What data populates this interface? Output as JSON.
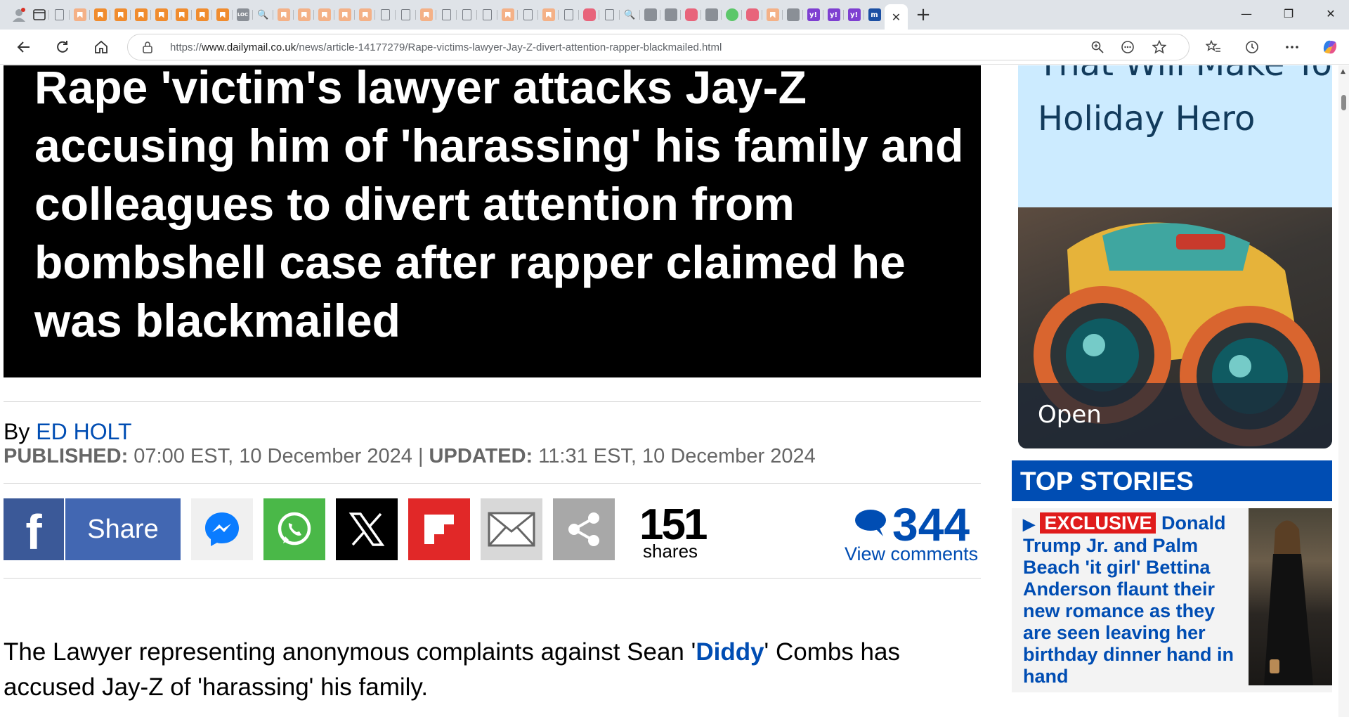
{
  "browser": {
    "url_prefix": "https://",
    "url_domain": "www.dailymail.co.uk",
    "url_path": "/news/article-14177279/Rape-victims-lawyer-Jay-Z-divert-attention-rapper-blackmailed.html",
    "tab_close_glyph": "✕",
    "new_tab_glyph": "+",
    "minimize_glyph": "—",
    "restore_glyph": "❐",
    "close_glyph": "✕",
    "tab_glyphs": {
      "bookmark_tab": "",
      "loc_tab": "LOC",
      "search_tab": "🔍",
      "yahoo_tab": "y!",
      "mail_tab": "m"
    }
  },
  "article": {
    "headline": "Rape 'victim's lawyer attacks Jay-Z accusing him of 'harassing' his family and colleagues to divert attention from bombshell case after rapper claimed he was blackmailed",
    "byline_prefix": "By ",
    "author": "ED HOLT",
    "published_label": "PUBLISHED:",
    "published_value": " 07:00 EST, 10 December 2024 ",
    "separator": "|",
    "updated_label": " UPDATED:",
    "updated_value": " 11:31 EST, 10 December 2024",
    "share_label": "Share",
    "shares_count": "151",
    "shares_label": "shares",
    "comments_count": "344",
    "view_comments": "View comments",
    "body_part1": " The Lawyer representing anonymous complaints against Sean '",
    "body_link": "Diddy",
    "body_part2": "' Combs has accused Jay-Z of 'harassing' his family."
  },
  "ad": {
    "top_line": "That Will Make You",
    "headline": "Holiday Hero",
    "open_label": "Open"
  },
  "sidebar": {
    "section_title": "TOP STORIES",
    "story_badge": "EXCLUSIVE",
    "story_text": " Donald Trump Jr. and Palm Beach 'it girl' Bettina Anderson flaunt their new romance as they are seen leaving her birthday dinner hand in hand"
  },
  "colors": {
    "accent": "#004db3",
    "headline_bg": "#000000",
    "exclusive": "#e01c1c"
  }
}
